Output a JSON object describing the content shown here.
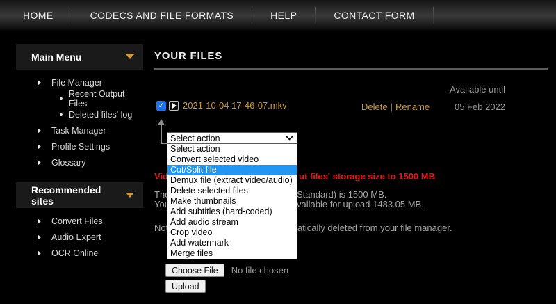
{
  "colors": {
    "accent_orange": "#cc9933",
    "highlight_blue": "#2196f3",
    "alert_red": "#ee1111",
    "checkbox_blue": "#1a73e8",
    "muted_gray": "#9a9a9a"
  },
  "nav": {
    "items": [
      {
        "label": "HOME"
      },
      {
        "label": "CODECS AND FILE FORMATS"
      },
      {
        "label": "HELP"
      },
      {
        "label": "CONTACT FORM"
      }
    ]
  },
  "sidebar": {
    "sections": [
      {
        "title": "Main Menu",
        "items": [
          {
            "label": "File Manager",
            "children": [
              {
                "label": "Recent Output Files"
              },
              {
                "label": "Deleted files' log"
              }
            ]
          },
          {
            "label": "Task Manager"
          },
          {
            "label": "Profile Settings"
          },
          {
            "label": "Glossary"
          }
        ]
      },
      {
        "title": "Recommended sites",
        "items": [
          {
            "label": "Convert Files"
          },
          {
            "label": "Audio Expert"
          },
          {
            "label": "OCR Online"
          }
        ]
      }
    ]
  },
  "main": {
    "title": "YOUR FILES",
    "available_until_label": "Available until",
    "file_row": {
      "checked": true,
      "name": "2021-10-04 17-46-07.mkv",
      "delete_label": "Delete",
      "separator": "|",
      "rename_label": "Rename",
      "available_until": "05 Feb 2022"
    },
    "action_select": {
      "selected": "Select action",
      "options": [
        "Select action",
        "Convert selected video",
        "Cut/Split file",
        "Demux file (extract video/audio)",
        "Delete selected files",
        "Make thumbnails",
        "Add subtitles (hard-coded)",
        "Add audio stream",
        "Crop video",
        "Add watermark",
        "Merge files"
      ],
      "highlighted_option": "Cut/Split file"
    },
    "background_messages": {
      "storage_alert": {
        "left_fragment": "Vid",
        "right_fragment": "ut files' storage size to 1500 MB"
      },
      "storage_line1": {
        "left_fragment": "The",
        "right_fragment": "Standard) is 1500 MB."
      },
      "storage_line2": {
        "left_fragment": "You",
        "right_fragment": "vailable for upload 1483.05 MB."
      },
      "note_line": {
        "left_fragment": "Not",
        "right_fragment": "atically deleted from your file manager."
      }
    },
    "upload_form": {
      "choose_file_label": "Choose File",
      "no_file_text": "No file chosen",
      "upload_label": "Upload"
    }
  }
}
